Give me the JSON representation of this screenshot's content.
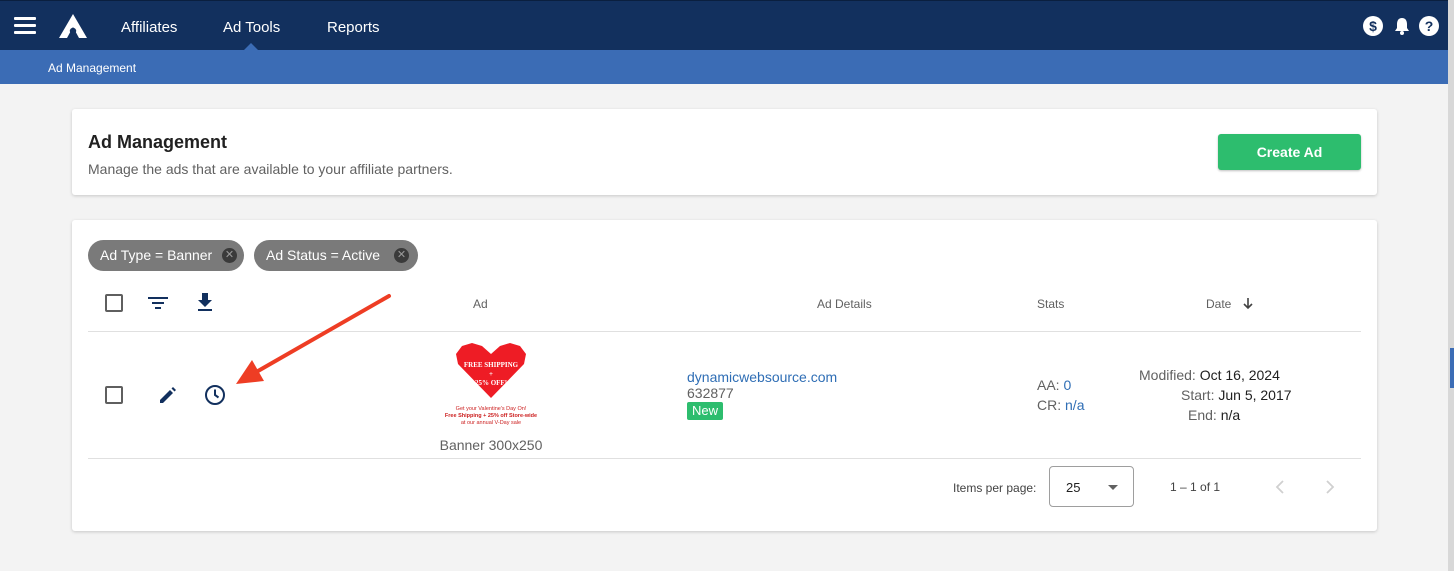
{
  "nav": {
    "items": [
      {
        "label": "Affiliates"
      },
      {
        "label": "Ad Tools"
      },
      {
        "label": "Reports"
      }
    ],
    "active": "Ad Tools"
  },
  "breadcrumb": {
    "label": "Ad Management"
  },
  "header": {
    "title": "Ad Management",
    "subtitle": "Manage the ads that are available to your affiliate partners.",
    "create_button": "Create Ad"
  },
  "filters": [
    {
      "label": "Ad Type = Banner"
    },
    {
      "label": "Ad Status = Active"
    }
  ],
  "table": {
    "columns": {
      "ad": "Ad",
      "details": "Ad Details",
      "stats": "Stats",
      "date": "Date"
    },
    "rows": [
      {
        "ad_caption": "Banner 300x250",
        "ad_image_text": {
          "line1": "FREE SHIPPING",
          "line2": "+",
          "line3": "25% OFF!",
          "line4": "Get your Valentine's Day On!",
          "line5": "Free Shipping + 25% off Store-wide",
          "line6": "at our annual V-Day sale"
        },
        "site": "dynamicwebsource.com",
        "id": "632877",
        "badge": "New",
        "stats": {
          "aa_label": "AA:",
          "aa_value": "0",
          "cr_label": "CR:",
          "cr_value": "n/a"
        },
        "dates": {
          "modified_label": "Modified:",
          "modified_value": "Oct 16, 2024",
          "start_label": "Start:",
          "start_value": "Jun 5, 2017",
          "end_label": "End:",
          "end_value": "n/a"
        }
      }
    ]
  },
  "pagination": {
    "items_per_page_label": "Items per page:",
    "items_per_page_value": "25",
    "range": "1 – 1 of 1"
  },
  "colors": {
    "topbar": "#12305e",
    "subbar": "#3b6cb5",
    "accent_green": "#2dbd6e",
    "annotation_arrow": "#ee3d24"
  }
}
